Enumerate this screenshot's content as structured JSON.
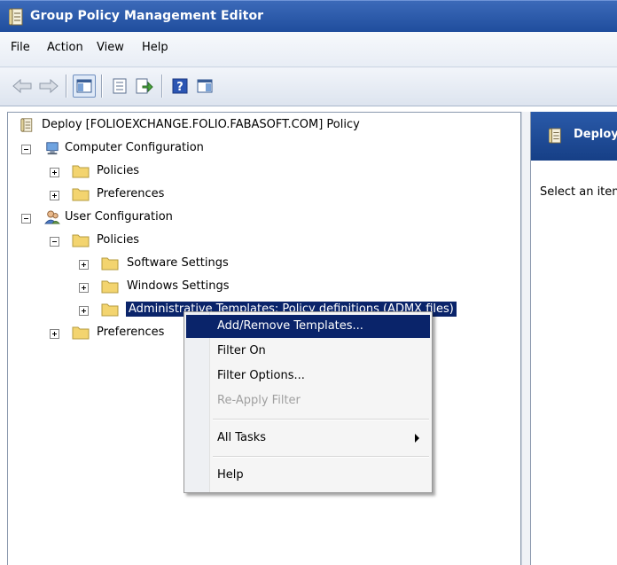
{
  "window": {
    "title": "Group Policy Management Editor"
  },
  "menu": [
    "File",
    "Action",
    "View",
    "Help"
  ],
  "toolbar": {
    "icons": [
      "back-arrow-icon",
      "forward-arrow-icon",
      "show-hide-tree-icon",
      "properties-icon",
      "export-list-icon",
      "help-icon",
      "extended-view-icon"
    ]
  },
  "tree": {
    "root": "Deploy [FOLIOEXCHANGE.FOLIO.FABASOFT.COM] Policy",
    "computer_configuration": "Computer Configuration",
    "computer_policies": "Policies",
    "computer_preferences": "Preferences",
    "user_configuration": "User Configuration",
    "user_policies": "Policies",
    "software_settings": "Software Settings",
    "windows_settings": "Windows Settings",
    "administrative_templates": "Administrative Templates: Policy definitions (ADMX files)",
    "user_preferences": "Preferences"
  },
  "right_pane": {
    "header": "Deploy",
    "instruction": "Select an item to view its description."
  },
  "context_menu": {
    "add_remove": "Add/Remove Templates...",
    "filter_on": "Filter On",
    "filter_options": "Filter Options...",
    "reapply_filter": "Re-Apply Filter",
    "all_tasks": "All Tasks",
    "help": "Help"
  },
  "colors": {
    "title_bar": "#2a5aa9",
    "selection": "#0a246a",
    "folder": "#f3d46f"
  }
}
